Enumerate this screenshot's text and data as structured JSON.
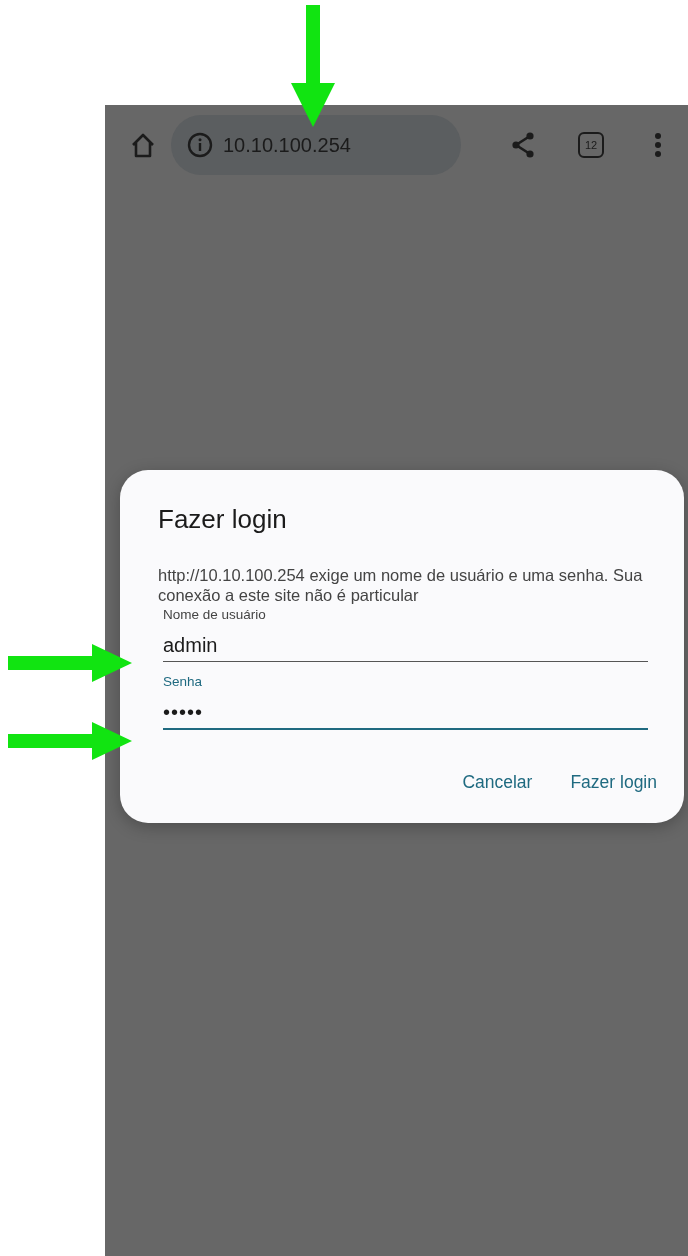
{
  "toolbar": {
    "url": "10.10.100.254",
    "tab_count": "12"
  },
  "dialog": {
    "title": "Fazer login",
    "message": "http://10.10.100.254 exige um nome de usuário e uma senha. Sua conexão a este site não é particular",
    "fields": [
      {
        "kind": "text",
        "label": "Nome de usuário",
        "value": "admin",
        "focused": false
      },
      {
        "kind": "password",
        "label": "Senha",
        "value": "•••••",
        "focused": true
      }
    ],
    "buttons": [
      "Cancelar",
      "Fazer login"
    ]
  },
  "arrows": [
    {
      "kind": "down"
    },
    {
      "kind": "right"
    },
    {
      "kind": "right"
    }
  ]
}
